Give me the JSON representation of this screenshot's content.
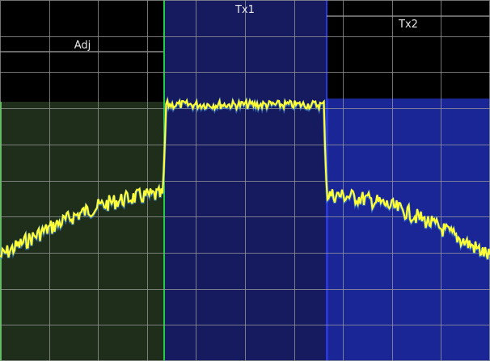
{
  "screen": {
    "background": "#000000",
    "grid_color": "#9a9a9a",
    "grid_columns": 10,
    "grid_rows": 10
  },
  "channels": [
    {
      "name": "adjacent-channel",
      "label": "Adj",
      "fill": "#1f2e1a",
      "border": "#44cc44",
      "span": [
        0.0,
        0.333
      ]
    },
    {
      "name": "tx1-channel",
      "label": "Tx1",
      "fill": "#161a5e",
      "border": "#22cc44",
      "span": [
        0.333,
        0.667
      ]
    },
    {
      "name": "tx2-channel",
      "label": "Tx2",
      "fill": "#1a2696",
      "border": "#2a36c8",
      "span": [
        0.667,
        1.0
      ]
    }
  ],
  "trace": {
    "color": "#ffff33",
    "shadow_color": "#3a80d0",
    "description_levels": {
      "noise_floor": 0.71,
      "adjacent_peak": 0.54,
      "tx1_plateau": 0.29,
      "tx2_start": 0.54,
      "tx2_end": 0.71
    }
  }
}
